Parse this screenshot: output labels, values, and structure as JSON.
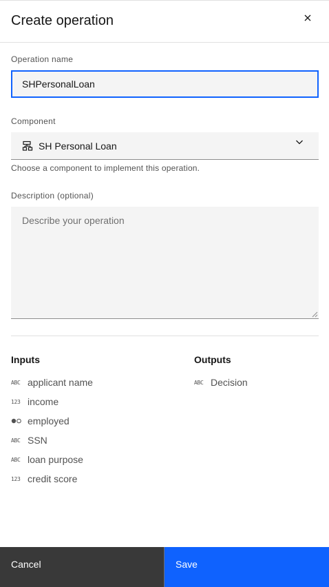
{
  "modal": {
    "title": "Create operation"
  },
  "form": {
    "operation_name": {
      "label": "Operation name",
      "value": "SHPersonalLoan"
    },
    "component": {
      "label": "Component",
      "value": "SH Personal Loan",
      "helper": "Choose a component to implement this operation."
    },
    "description": {
      "label": "Description (optional)",
      "placeholder": "Describe your operation"
    }
  },
  "inputs": {
    "title": "Inputs",
    "items": [
      {
        "type_icon": "ABC",
        "label": "applicant name"
      },
      {
        "type_icon": "123",
        "label": "income"
      },
      {
        "type_icon": "boolean",
        "label": "employed"
      },
      {
        "type_icon": "ABC",
        "label": "SSN"
      },
      {
        "type_icon": "ABC",
        "label": "loan purpose"
      },
      {
        "type_icon": "123",
        "label": "credit score"
      }
    ]
  },
  "outputs": {
    "title": "Outputs",
    "items": [
      {
        "type_icon": "ABC",
        "label": "Decision"
      }
    ]
  },
  "footer": {
    "cancel_label": "Cancel",
    "save_label": "Save"
  },
  "colors": {
    "primary": "#0f62fe",
    "secondary_button": "#393939"
  }
}
